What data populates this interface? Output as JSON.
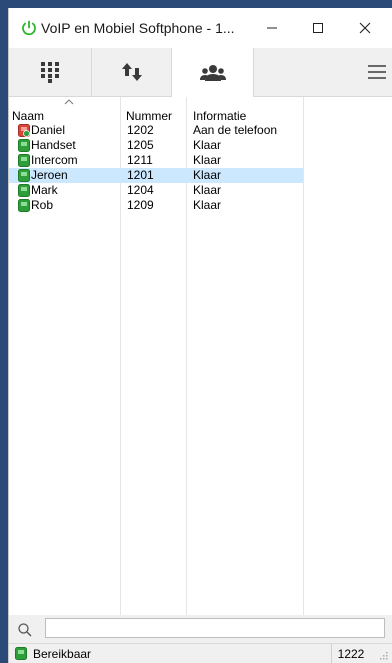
{
  "window": {
    "title": "VoIP en Mobiel Softphone - 1...",
    "accent": "#2db52d"
  },
  "toolbar": {
    "tabs": [
      {
        "name": "dialpad",
        "icon": "dialpad-icon",
        "selected": false
      },
      {
        "name": "calls",
        "icon": "transfer-arrows-icon",
        "selected": false
      },
      {
        "name": "contacts",
        "icon": "contacts-icon",
        "selected": true
      }
    ],
    "menu_icon": "hamburger-icon"
  },
  "columns": {
    "name": "Naam",
    "number": "Nummer",
    "info": "Informatie"
  },
  "rows": [
    {
      "name": "Daniel",
      "number": "1202",
      "info": "Aan de telefoon",
      "status": "busy",
      "selected": false
    },
    {
      "name": "Handset",
      "number": "1205",
      "info": "Klaar",
      "status": "available",
      "selected": false
    },
    {
      "name": "Intercom",
      "number": "1211",
      "info": "Klaar",
      "status": "available",
      "selected": false
    },
    {
      "name": "Jeroen",
      "number": "1201",
      "info": "Klaar",
      "status": "available",
      "selected": true
    },
    {
      "name": "Mark",
      "number": "1204",
      "info": "Klaar",
      "status": "available",
      "selected": false
    },
    {
      "name": "Rob",
      "number": "1209",
      "info": "Klaar",
      "status": "available",
      "selected": false
    }
  ],
  "search": {
    "value": "",
    "placeholder": ""
  },
  "status": {
    "text": "Bereikbaar",
    "extension": "1222"
  },
  "colors": {
    "available": "#2e9e3a",
    "busy": "#d9453a",
    "selected_row": "#cce8ff"
  }
}
